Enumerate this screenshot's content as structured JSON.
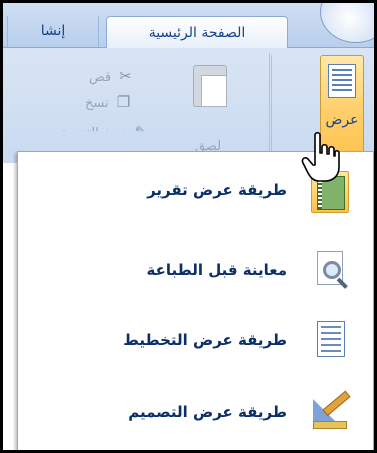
{
  "ribbon": {
    "tabs": [
      {
        "label": "الصفحة الرئيسية",
        "active": true
      },
      {
        "label": "إنشا",
        "active": false
      }
    ],
    "views_group": {
      "view_button_label": "عرض"
    },
    "clipboard_group": {
      "paste_label": "لصق",
      "cut_label": "قص",
      "copy_label": "نسخ",
      "format_painter_label": "نسخ التنسيق"
    }
  },
  "menu": {
    "items": [
      {
        "label": "طريقة عرض تقرير",
        "icon": "report-view-icon"
      },
      {
        "label": "معاينة قبل الطباعة",
        "icon": "print-preview-icon"
      },
      {
        "label": "طريقة عرض التخطيط",
        "icon": "layout-view-icon"
      },
      {
        "label": "طريقة عرض التصميم",
        "icon": "design-view-icon"
      }
    ]
  },
  "colors": {
    "ribbon_bg": "#c9daf0",
    "tab_text": "#15428b",
    "menu_text": "#0b2f6b",
    "highlight": "#ffc14a"
  }
}
